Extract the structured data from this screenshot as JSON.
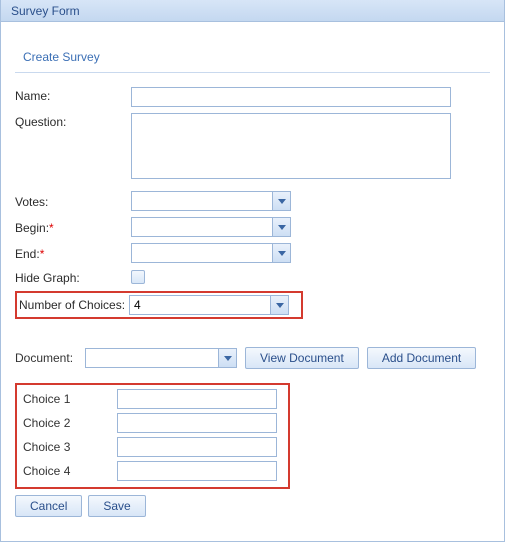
{
  "window": {
    "title": "Survey Form"
  },
  "section": {
    "title": "Create Survey"
  },
  "fields": {
    "name": {
      "label": "Name:",
      "value": ""
    },
    "question": {
      "label": "Question:",
      "value": ""
    },
    "votes": {
      "label": "Votes:",
      "value": ""
    },
    "begin": {
      "label": "Begin:",
      "value": ""
    },
    "end": {
      "label": "End:",
      "value": ""
    },
    "hide_graph": {
      "label": "Hide Graph:"
    },
    "num_choices": {
      "label": "Number of Choices:",
      "value": "4"
    },
    "document": {
      "label": "Document:",
      "value": ""
    }
  },
  "buttons": {
    "view_document": "View Document",
    "add_document": "Add Document",
    "cancel": "Cancel",
    "save": "Save"
  },
  "choices": [
    {
      "label": "Choice 1",
      "value": ""
    },
    {
      "label": "Choice 2",
      "value": ""
    },
    {
      "label": "Choice 3",
      "value": ""
    },
    {
      "label": "Choice 4",
      "value": ""
    }
  ]
}
